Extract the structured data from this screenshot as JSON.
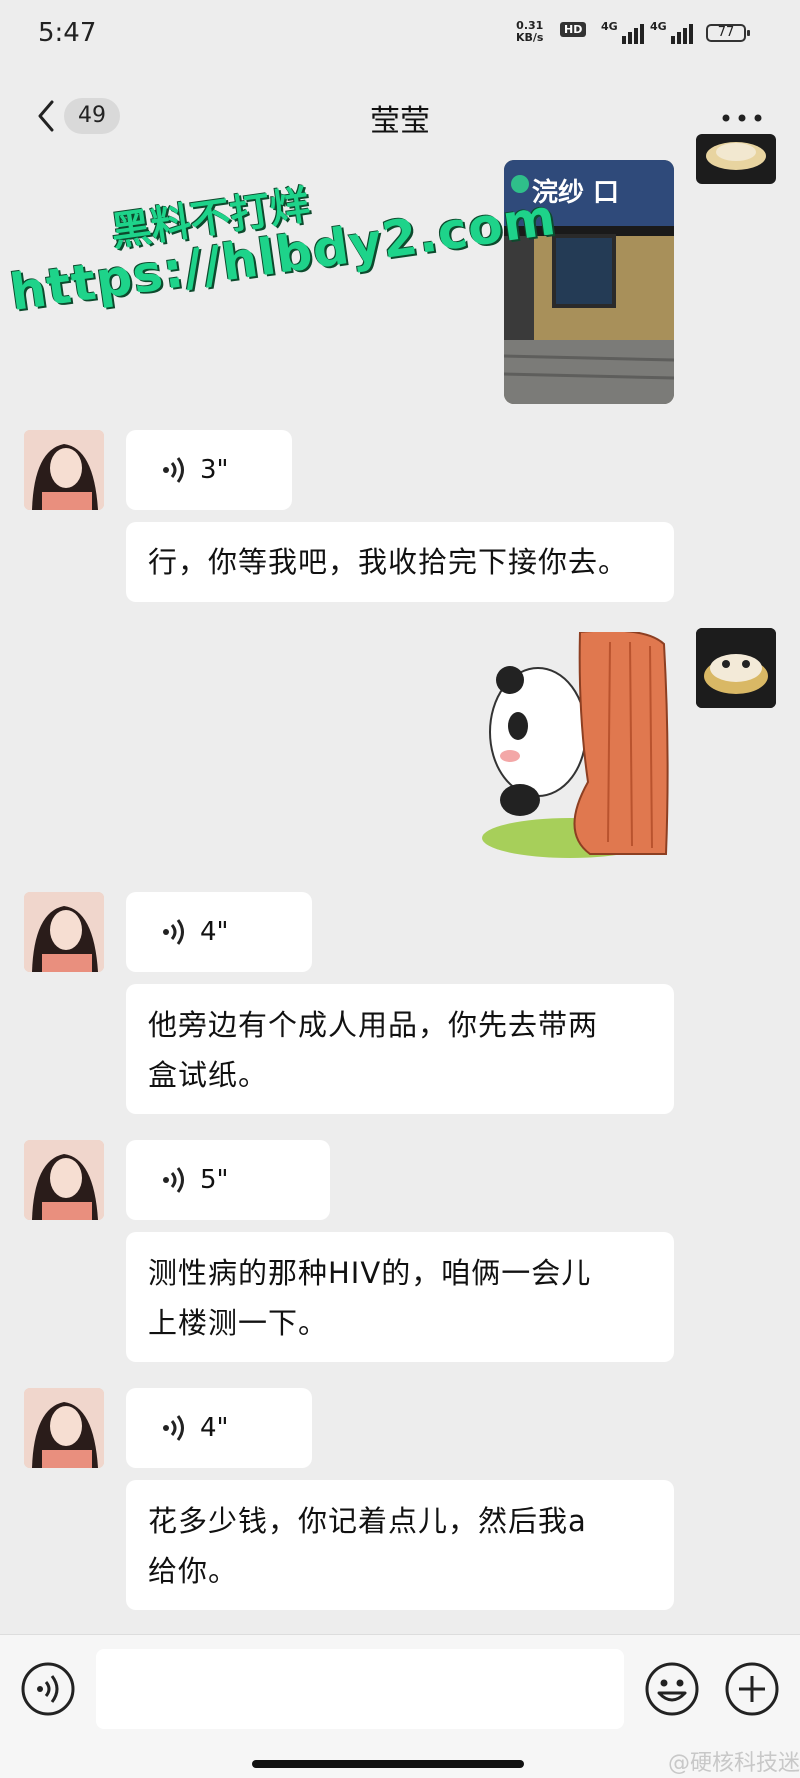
{
  "status_bar": {
    "time": "5:47",
    "net_speed_value": "0.31",
    "net_speed_unit": "KB/s",
    "hd_label": "HD",
    "signal1_label": "4G",
    "signal2_label": "4G",
    "battery": "77"
  },
  "nav": {
    "unread_count": "49",
    "title": "莹莹"
  },
  "watermark": {
    "line1": "黑料不打烊",
    "line2": "https://hlbdy2.com"
  },
  "messages": {
    "image_storefront_sign": "浣纱 口",
    "voice1_duration": "3\"",
    "text1": "行，你等我吧，我收拾完下接你去。",
    "voice2_duration": "4\"",
    "text2_line1": "他旁边有个成人用品，你先去带两",
    "text2_line2": "盒试纸。",
    "voice3_duration": "5\"",
    "text3_line1": "测性病的那种HIV的，咱俩一会儿",
    "text3_line2": "上楼测一下。",
    "voice4_duration": "4\"",
    "text4_line1": "花多少钱，你记着点儿，然后我a",
    "text4_line2": "给你。"
  },
  "input": {
    "placeholder": ""
  },
  "credit": "@硬核科技迷",
  "colors": {
    "background": "#ededed",
    "bubble": "#ffffff",
    "watermark": "#1ed38a"
  }
}
